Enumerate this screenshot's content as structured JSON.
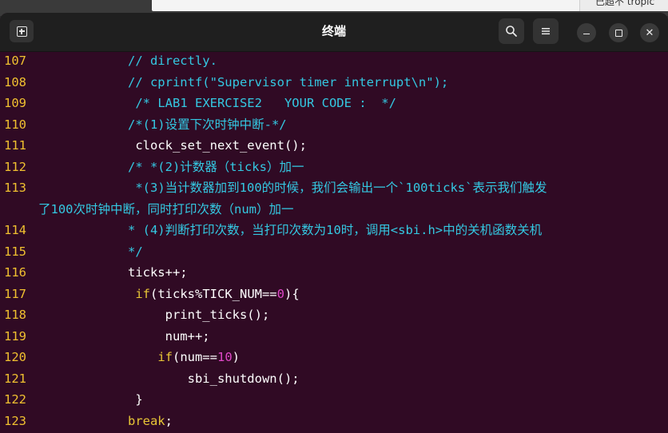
{
  "background": {
    "peek_text": "已超不 tropic"
  },
  "window": {
    "title": "终端",
    "background_color": "#300a24",
    "line_number_color": "#f0c030",
    "comment_color": "#34c8e2",
    "keyword_color": "#e8c636",
    "number_color": "#e048c8"
  },
  "toolbar": {
    "new_tab_icon": "new-tab-icon",
    "search_icon": "search-icon",
    "menu_icon": "hamburger-menu-icon",
    "minimize_icon": "minimize-icon",
    "maximize_icon": "maximize-icon",
    "close_icon": "close-icon"
  },
  "lines": [
    {
      "num": "107",
      "indent": "            ",
      "parts": [
        {
          "t": "c",
          "s": "// directly."
        }
      ]
    },
    {
      "num": "108",
      "indent": "            ",
      "parts": [
        {
          "t": "c",
          "s": "// cprintf(\"Supervisor timer interrupt\\n\");"
        }
      ]
    },
    {
      "num": "109",
      "indent": "             ",
      "parts": [
        {
          "t": "c",
          "s": "/* LAB1 EXERCISE2   YOUR CODE :  */"
        }
      ]
    },
    {
      "num": "110",
      "indent": "            ",
      "parts": [
        {
          "t": "c",
          "s": "/*(1)设置下次时钟中断-*/"
        }
      ]
    },
    {
      "num": "111",
      "indent": "             ",
      "parts": [
        {
          "t": "w",
          "s": "clock_set_next_event();"
        }
      ]
    },
    {
      "num": "112",
      "indent": "            ",
      "parts": [
        {
          "t": "c",
          "s": "/* *(2)计数器（ticks）加一"
        }
      ]
    },
    {
      "num": "113",
      "indent": "             ",
      "parts": [
        {
          "t": "c",
          "s": "*(3)当计数器加到100的时候，我们会输出一个`100ticks`表示我们触发"
        }
      ]
    },
    {
      "num": "",
      "indent": "",
      "parts": [
        {
          "t": "c",
          "s": "了100次时钟中断，同时打印次数（num）加一"
        }
      ]
    },
    {
      "num": "114",
      "indent": "            ",
      "parts": [
        {
          "t": "c",
          "s": "* (4)判断打印次数，当打印次数为10时，调用<sbi.h>中的关机函数关机"
        }
      ]
    },
    {
      "num": "115",
      "indent": "            ",
      "parts": [
        {
          "t": "c",
          "s": "*/"
        }
      ]
    },
    {
      "num": "116",
      "indent": "            ",
      "parts": [
        {
          "t": "w",
          "s": "ticks++;"
        }
      ]
    },
    {
      "num": "117",
      "indent": "             ",
      "parts": [
        {
          "t": "k",
          "s": "if"
        },
        {
          "t": "w",
          "s": "(ticks%TICK_NUM=="
        },
        {
          "t": "n",
          "s": "0"
        },
        {
          "t": "w",
          "s": "){"
        }
      ]
    },
    {
      "num": "118",
      "indent": "                 ",
      "parts": [
        {
          "t": "w",
          "s": "print_ticks();"
        }
      ]
    },
    {
      "num": "119",
      "indent": "                 ",
      "parts": [
        {
          "t": "w",
          "s": "num++;"
        }
      ]
    },
    {
      "num": "120",
      "indent": "                ",
      "parts": [
        {
          "t": "k",
          "s": "if"
        },
        {
          "t": "w",
          "s": "(num=="
        },
        {
          "t": "n",
          "s": "10"
        },
        {
          "t": "w",
          "s": ")"
        }
      ]
    },
    {
      "num": "121",
      "indent": "                    ",
      "parts": [
        {
          "t": "w",
          "s": "sbi_shutdown();"
        }
      ]
    },
    {
      "num": "122",
      "indent": "             ",
      "parts": [
        {
          "t": "w",
          "s": "}"
        }
      ]
    },
    {
      "num": "123",
      "indent": "            ",
      "parts": [
        {
          "t": "k",
          "s": "break"
        },
        {
          "t": "w",
          "s": ";"
        }
      ]
    }
  ]
}
